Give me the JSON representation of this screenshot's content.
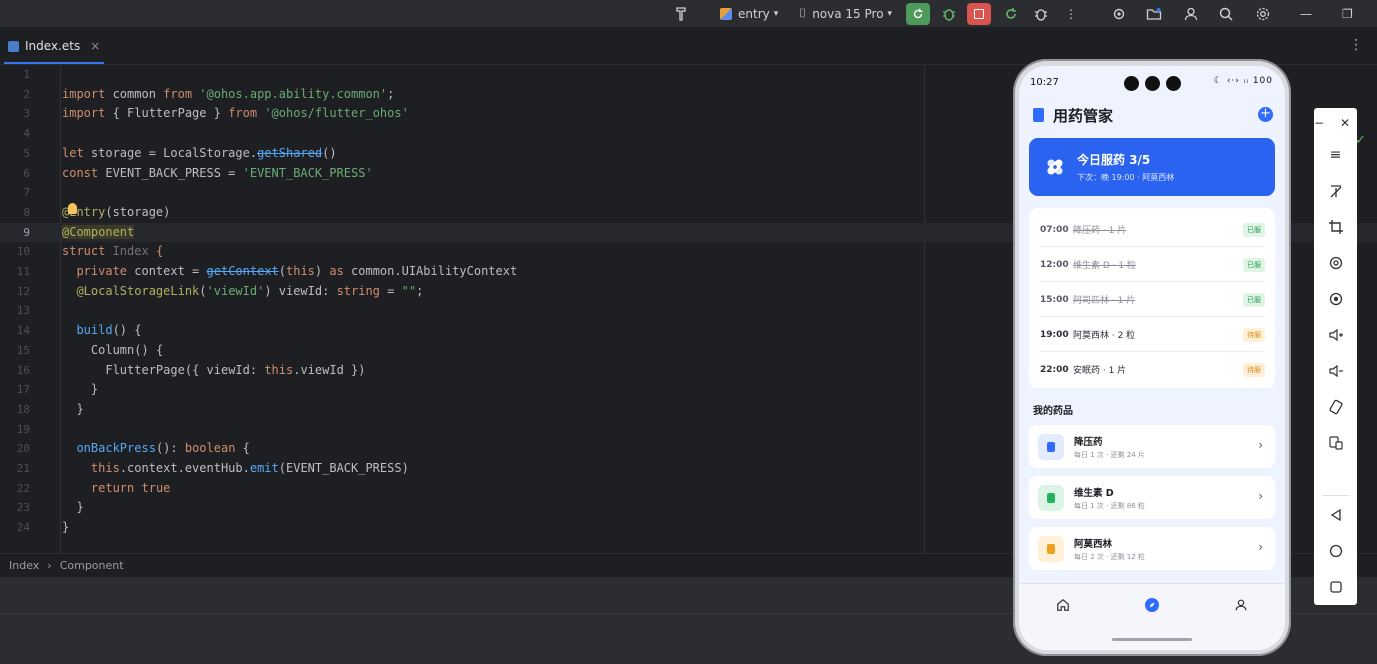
{
  "toolbar": {
    "module": "entry",
    "device": "nova 15 Pro"
  },
  "tab": {
    "filename": "Index.ets",
    "close": "×"
  },
  "code_lines": [
    {
      "n": "1"
    },
    {
      "n": "2"
    },
    {
      "n": "3"
    },
    {
      "n": "4"
    },
    {
      "n": "5"
    },
    {
      "n": "6"
    },
    {
      "n": "7"
    },
    {
      "n": "8"
    },
    {
      "n": "9"
    },
    {
      "n": "10"
    },
    {
      "n": "11"
    },
    {
      "n": "12"
    },
    {
      "n": "13"
    },
    {
      "n": "14"
    },
    {
      "n": "15"
    },
    {
      "n": "16"
    },
    {
      "n": "17"
    },
    {
      "n": "18"
    },
    {
      "n": "19"
    },
    {
      "n": "20"
    },
    {
      "n": "21"
    },
    {
      "n": "22"
    },
    {
      "n": "23"
    },
    {
      "n": "24"
    }
  ],
  "code": {
    "l2a": "import",
    "l2b": " common ",
    "l2c": "from",
    "l2d": " '@ohos.app.ability.common'",
    "l2e": ";",
    "l3a": "import",
    "l3b": " { FlutterPage } ",
    "l3c": "from",
    "l3d": " '@ohos/flutter_ohos'",
    "l5a": "let",
    "l5b": " storage = LocalStorage.",
    "l5c": "getShared",
    "l5d": "()",
    "l6a": "const",
    "l6b": " EVENT_BACK_PRESS = ",
    "l6c": "'EVENT_BACK_PRESS'",
    "l8a": "@Entry",
    "l8b": "(storage)",
    "l9a": "@Component",
    "l10a": "struct",
    "l10b": " Index ",
    "l10c": "{",
    "l11a": "private",
    "l11b": " context = ",
    "l11c": "getContext",
    "l11d": "(",
    "l11e": "this",
    "l11f": ") ",
    "l11g": "as",
    "l11h": " common.",
    "l11i": "UIAbilityContext",
    "l12a": "@LocalStorageLink",
    "l12b": "(",
    "l12c": "'viewId'",
    "l12d": ") viewId: ",
    "l12e": "string",
    "l12f": " = ",
    "l12g": "\"\"",
    "l12h": ";",
    "l14a": "build",
    "l14b": "() {",
    "l15a": "Column",
    "l15b": "() {",
    "l16a": "FlutterPage",
    "l16b": "({ viewId: ",
    "l16c": "this",
    "l16d": ".viewId })",
    "l17a": "}",
    "l18a": "}",
    "l20a": "onBackPress",
    "l20b": "(): ",
    "l20c": "boolean",
    "l20d": " {",
    "l21a": "this",
    "l21b": ".context.eventHub.",
    "l21c": "emit",
    "l21d": "(EVENT_BACK_PRESS)",
    "l22a": "return",
    "l22b": " ",
    "l22c": "true",
    "l23a": "}",
    "l24a": "}"
  },
  "breadcrumb": {
    "first": "Index",
    "sep": "›",
    "second": "Component"
  },
  "phone": {
    "time": "10:27",
    "status_icons": "☾ ‹·› ᵢᵢ 100",
    "app_title": "用药管家",
    "plus": "+",
    "hero": {
      "title": "今日服药 3/5",
      "subtitle": "下次：晚 19:00 · 阿莫西林"
    },
    "schedule": [
      {
        "time": "07:00",
        "med": "降压药 · 1 片",
        "status": "已服",
        "done": true
      },
      {
        "time": "12:00",
        "med": "维生素 D · 1 粒",
        "status": "已服",
        "done": true
      },
      {
        "time": "15:00",
        "med": "阿司匹林 · 1 片",
        "status": "已服",
        "done": true
      },
      {
        "time": "19:00",
        "med": "阿莫西林 · 2 粒",
        "status": "待服",
        "done": false
      },
      {
        "time": "22:00",
        "med": "安眠药 · 1 片",
        "status": "待服",
        "done": false
      }
    ],
    "section_title": "我的药品",
    "drugs": [
      {
        "name": "降压药",
        "desc": "每日 1 次 · 还剩 24 片",
        "bg": "#e3ebff",
        "fg": "#2f6bff"
      },
      {
        "name": "维生素 D",
        "desc": "每日 1 次 · 还剩 86 粒",
        "bg": "#dcf4e5",
        "fg": "#26b360"
      },
      {
        "name": "阿莫西林",
        "desc": "每日 2 次 · 还剩 12 粒",
        "bg": "#fff0d8",
        "fg": "#f0a020"
      }
    ],
    "chevron": "›"
  },
  "colors": {
    "accent": "#2a63f0",
    "ok": "#2c9b54",
    "wait": "#d98a16"
  }
}
